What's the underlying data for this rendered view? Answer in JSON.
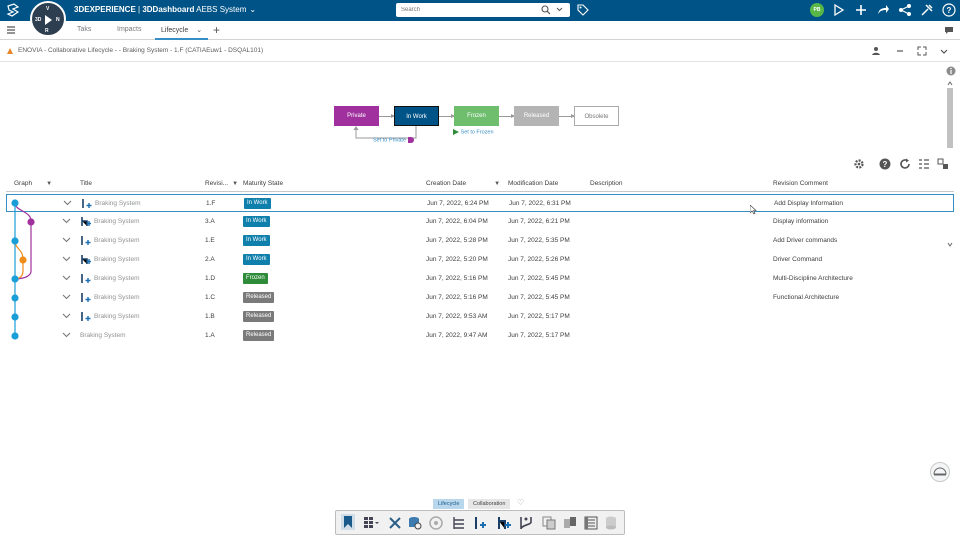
{
  "topbar": {
    "compass_labels": [
      "3D",
      "V",
      "N",
      "R"
    ],
    "brand_bold": "3DEXPERIENCE",
    "brand_app": "3DDashboard",
    "brand_context": "AEBS System",
    "search_placeholder": "Search",
    "avatar_initials": "PB",
    "bar_color": "#005386"
  },
  "tabs": {
    "items": [
      {
        "label": "Taks"
      },
      {
        "label": "Impacts"
      },
      {
        "label": "Lifecycle"
      }
    ]
  },
  "breadcrumb": {
    "text": "ENOVIA - Collaborative Lifecycle - - Braking System - 1.F (CATIAEuw1 - DSQAL101)"
  },
  "lifecycle": {
    "states": [
      {
        "label": "Private",
        "color": "#a0309e"
      },
      {
        "label": "In Work",
        "color": "#005386"
      },
      {
        "label": "Frozen",
        "color": "#6ebe6e"
      },
      {
        "label": "Released",
        "color": "#b4b4b4"
      },
      {
        "label": "Obsolete",
        "color": "#ffffff"
      }
    ],
    "set_to_private": "Set to Private",
    "set_to_frozen": "Set to Frozen"
  },
  "table": {
    "headers": {
      "graph": "Graph",
      "title": "Title",
      "revision": "Revisi...",
      "maturity": "Maturity State",
      "created": "Creation Date",
      "modified": "Modification Date",
      "description": "Description",
      "comment": "Revision Comment"
    },
    "rows": [
      {
        "title": "Braking System",
        "rev": "1.F",
        "state": "In Work",
        "created": "Jun 7, 2022, 6:24 PM",
        "modified": "Jun 7, 2022, 6:31 PM",
        "comment": "Add Display Information"
      },
      {
        "title": "Braking System",
        "rev": "3.A",
        "state": "In Work",
        "created": "Jun 7, 2022, 6:04 PM",
        "modified": "Jun 7, 2022, 6:21 PM",
        "comment": "Display information"
      },
      {
        "title": "Braking System",
        "rev": "1.E",
        "state": "In Work",
        "created": "Jun 7, 2022, 5:28 PM",
        "modified": "Jun 7, 2022, 5:35 PM",
        "comment": "Add Driver commands"
      },
      {
        "title": "Braking System",
        "rev": "2.A",
        "state": "In Work",
        "created": "Jun 7, 2022, 5:20 PM",
        "modified": "Jun 7, 2022, 5:26 PM",
        "comment": "Driver Command"
      },
      {
        "title": "Braking System",
        "rev": "1.D",
        "state": "Frozen",
        "created": "Jun 7, 2022, 5:16 PM",
        "modified": "Jun 7, 2022, 5:45 PM",
        "comment": "Multi-Discipline Architecture"
      },
      {
        "title": "Braking System",
        "rev": "1.C",
        "state": "Released",
        "created": "Jun 7, 2022, 5:16 PM",
        "modified": "Jun 7, 2022, 5:45 PM",
        "comment": "Functional Architecture"
      },
      {
        "title": "Braking System",
        "rev": "1.B",
        "state": "Released",
        "created": "Jun 7, 2022, 9:53 AM",
        "modified": "Jun 7, 2022, 5:17 PM",
        "comment": ""
      },
      {
        "title": "Braking System",
        "rev": "1.A",
        "state": "Released",
        "created": "Jun 7, 2022, 9:47 AM",
        "modified": "Jun 7, 2022, 5:17 PM",
        "comment": ""
      }
    ],
    "state_colors": {
      "In Work": "#0f7fab",
      "Frozen": "#2e8b3a",
      "Released": "#7a7a7a"
    }
  },
  "bottom": {
    "tabs": [
      {
        "label": "Lifecycle"
      },
      {
        "label": "Collaboration"
      }
    ]
  }
}
